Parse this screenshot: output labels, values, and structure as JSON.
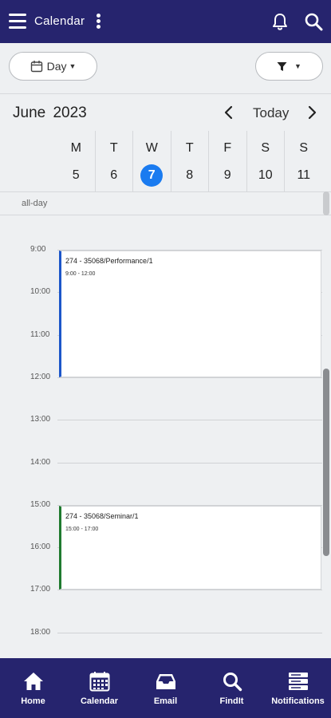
{
  "header": {
    "title": "Calendar"
  },
  "toolbar": {
    "view_label": "Day",
    "filter_label": ""
  },
  "calendar": {
    "month_label": "June 2023",
    "today_label": "Today",
    "allday_label": "all-day",
    "days": [
      {
        "dow": "M",
        "num": "5"
      },
      {
        "dow": "T",
        "num": "6"
      },
      {
        "dow": "W",
        "num": "7"
      },
      {
        "dow": "T",
        "num": "8"
      },
      {
        "dow": "F",
        "num": "9"
      },
      {
        "dow": "S",
        "num": "10"
      },
      {
        "dow": "S",
        "num": "11"
      }
    ],
    "selected_day_index": 2,
    "hours": [
      "9:00",
      "10:00",
      "11:00",
      "12:00",
      "13:00",
      "14:00",
      "15:00",
      "16:00",
      "17:00",
      "18:00"
    ],
    "events": [
      {
        "title": "274 - 35068/Performance/1",
        "time": "9:00 - 12:00",
        "color": "#1c56c9"
      },
      {
        "title": "274 - 35068/Seminar/1",
        "time": "15:00 - 17:00",
        "color": "#1f7a2f"
      }
    ]
  },
  "nav": {
    "items": [
      {
        "label": "Home",
        "icon": "home-icon"
      },
      {
        "label": "Calendar",
        "icon": "calendar-icon"
      },
      {
        "label": "Email",
        "icon": "inbox-icon"
      },
      {
        "label": "FindIt",
        "icon": "search-icon"
      },
      {
        "label": "Notifications",
        "icon": "notifications-icon"
      }
    ]
  },
  "colors": {
    "brand": "#26246e",
    "selected_day": "#1a7bf0"
  }
}
